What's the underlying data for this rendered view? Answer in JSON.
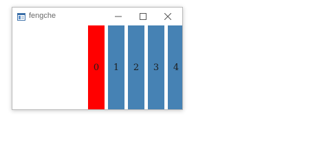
{
  "window": {
    "title": "fengche",
    "icon": "window-app-icon",
    "controls": [
      "minimize-icon",
      "maximize-icon",
      "close-icon"
    ]
  },
  "tiles": [
    {
      "label": "0",
      "color": "#ff0000",
      "state": "selected"
    },
    {
      "label": "1",
      "color": "#4682b4",
      "state": "normal"
    },
    {
      "label": "2",
      "color": "#4682b4",
      "state": "normal"
    },
    {
      "label": "3",
      "color": "#4682b4",
      "state": "normal"
    },
    {
      "label": "4",
      "color": "#4682b4",
      "state": "normal"
    }
  ]
}
